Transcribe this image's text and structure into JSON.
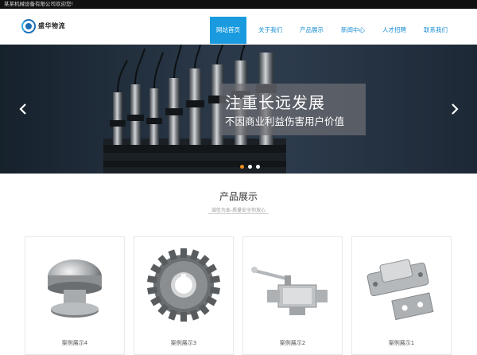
{
  "topbar": {
    "welcome": "某某机械设备有限公司欢迎您!"
  },
  "header": {
    "logo_text": "盛华物流"
  },
  "nav": {
    "items": [
      "网站首页",
      "关于我们",
      "产品展示",
      "新闻中心",
      "人才招聘",
      "联系我们"
    ],
    "active_index": 0
  },
  "hero": {
    "title": "注重长远发展",
    "subtitle": "不因商业利益伤害用户价值",
    "prev_icon": "chevron-left-icon",
    "next_icon": "chevron-right-icon",
    "slide_count": 3,
    "active_slide": 0
  },
  "products": {
    "title": "产品展示",
    "subtitle": "诚信为本-质量安全你放心",
    "items": [
      {
        "label": "案例展示4",
        "image": "metal-cap-valve"
      },
      {
        "label": "案例展示3",
        "image": "spur-gear"
      },
      {
        "label": "案例展示2",
        "image": "ball-valve"
      },
      {
        "label": "案例展示1",
        "image": "hinge-bracket"
      }
    ]
  },
  "colors": {
    "accent": "#1a9be0",
    "nav_text": "#1a8ed3",
    "active_dot": "#f08a1c",
    "topbar": "#111111"
  }
}
